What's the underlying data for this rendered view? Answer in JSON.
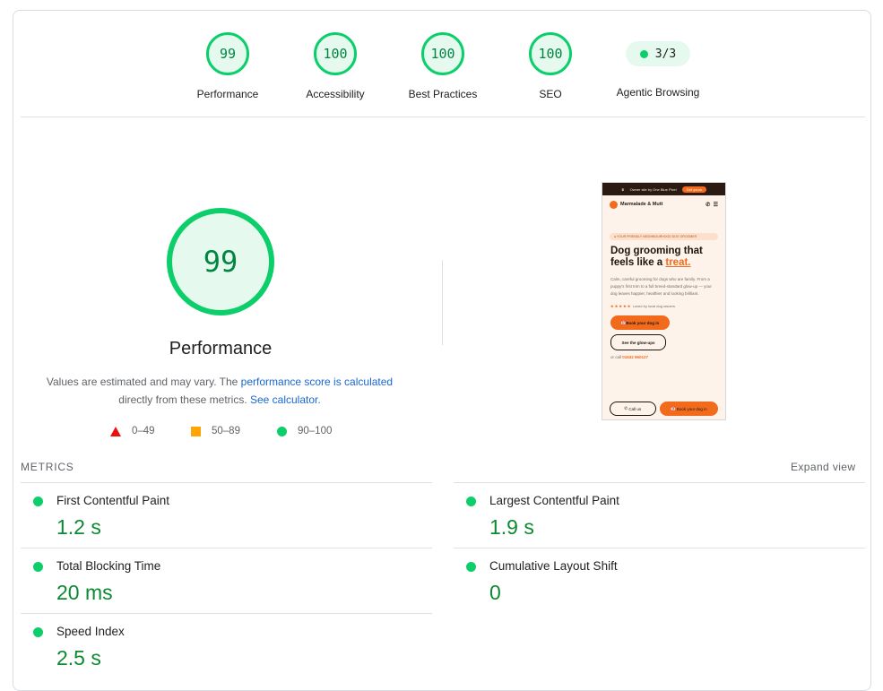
{
  "scores": [
    {
      "value": "99",
      "label": "Performance"
    },
    {
      "value": "100",
      "label": "Accessibility"
    },
    {
      "value": "100",
      "label": "Best Practices"
    },
    {
      "value": "100",
      "label": "SEO"
    }
  ],
  "agentic": {
    "value": "3/3",
    "label": "Agentic Browsing"
  },
  "performance": {
    "score": "99",
    "title": "Performance",
    "desc_prefix": "Values are estimated and may vary. The ",
    "link1": "performance score is calculated",
    "desc_mid": "directly from these metrics. ",
    "link2": "See calculator",
    "desc_suffix": "."
  },
  "legend": {
    "fail": "0–49",
    "average": "50–89",
    "pass": "90–100"
  },
  "screenshot": {
    "banner": "Owner site by One Blue Pixel",
    "banner_btn": "Get yours",
    "brand": "Marmalade & Mutt",
    "badge": "YOUR FRIENDLY NEIGHBOURHOOD DOG GROOMER",
    "headline_a": "Dog grooming that feels like a ",
    "headline_hl": "treat.",
    "para": "Calm, careful grooming for dogs who are family. From a puppy's first trim to a full breed-standard glow-up — your dog leaves happier, healthier and looking brilliant.",
    "stars": "★ ★ ★ ★ ★",
    "stars_text": "Loved by local dog owners",
    "btn_book": "Book your dog in",
    "btn_glow": "See the glow-ups",
    "call_prefix": "or call ",
    "call_number": "01632 960127",
    "bottom_call": "Call us",
    "bottom_book": "Book your dog in"
  },
  "metrics": {
    "header": "METRICS",
    "expand": "Expand view",
    "items": [
      {
        "name": "First Contentful Paint",
        "value": "1.2 s"
      },
      {
        "name": "Largest Contentful Paint",
        "value": "1.9 s"
      },
      {
        "name": "Total Blocking Time",
        "value": "20 ms"
      },
      {
        "name": "Cumulative Layout Shift",
        "value": "0"
      },
      {
        "name": "Speed Index",
        "value": "2.5 s"
      }
    ]
  },
  "colors": {
    "pass": "#0cce6b",
    "average": "#ffa400",
    "fail": "#eb0f0f",
    "pass_text": "#0c8a31"
  }
}
